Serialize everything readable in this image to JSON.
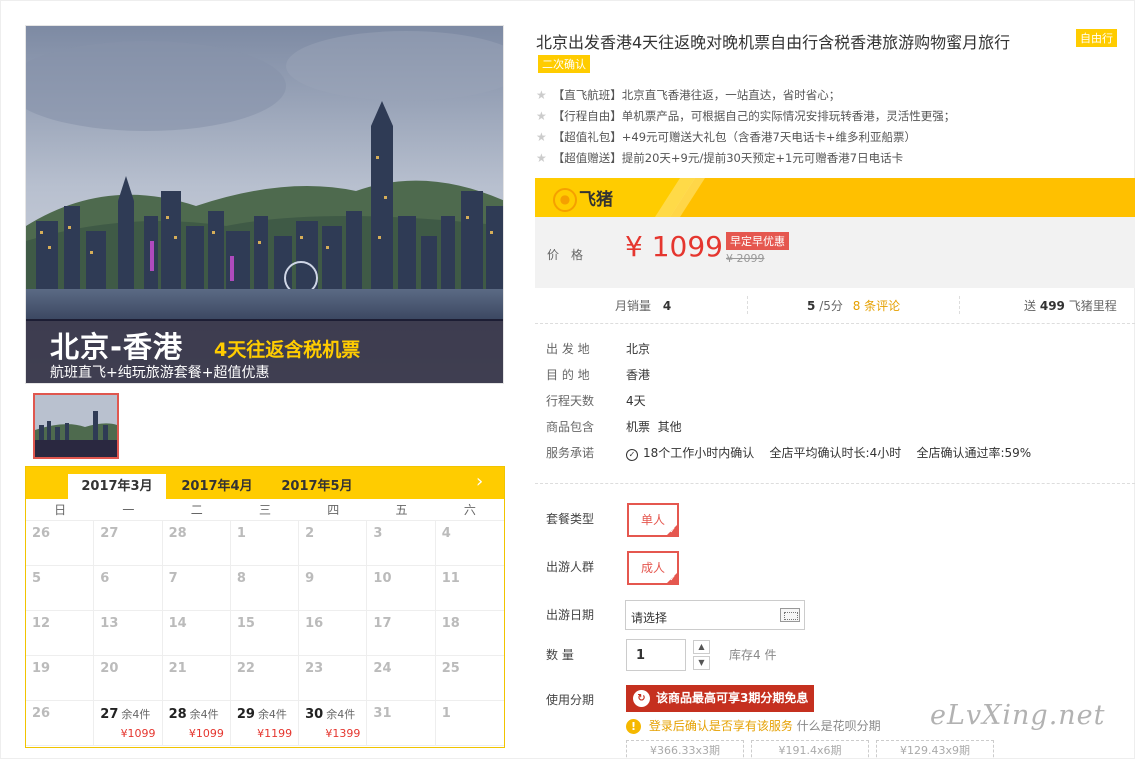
{
  "hero": {
    "title_main": "北京-香港",
    "title_sub": "4天往返含税机票",
    "caption": "航班直飞+纯玩旅游套餐+超值优惠"
  },
  "calendar": {
    "months": [
      "2017年3月",
      "2017年4月",
      "2017年5月"
    ],
    "weekdays": [
      "日",
      "一",
      "二",
      "三",
      "四",
      "五",
      "六"
    ],
    "cells": [
      {
        "day": "26"
      },
      {
        "day": "27"
      },
      {
        "day": "28"
      },
      {
        "day": "1"
      },
      {
        "day": "2"
      },
      {
        "day": "3"
      },
      {
        "day": "4"
      },
      {
        "day": "5"
      },
      {
        "day": "6"
      },
      {
        "day": "7"
      },
      {
        "day": "8"
      },
      {
        "day": "9"
      },
      {
        "day": "10"
      },
      {
        "day": "11"
      },
      {
        "day": "12"
      },
      {
        "day": "13"
      },
      {
        "day": "14"
      },
      {
        "day": "15"
      },
      {
        "day": "16"
      },
      {
        "day": "17"
      },
      {
        "day": "18"
      },
      {
        "day": "19"
      },
      {
        "day": "20"
      },
      {
        "day": "21"
      },
      {
        "day": "22"
      },
      {
        "day": "23"
      },
      {
        "day": "24"
      },
      {
        "day": "25"
      },
      {
        "day": "26"
      },
      {
        "day": "27",
        "stock": "余4件",
        "price": "¥1099"
      },
      {
        "day": "28",
        "stock": "余4件",
        "price": "¥1099"
      },
      {
        "day": "29",
        "stock": "余4件",
        "price": "¥1199"
      },
      {
        "day": "30",
        "stock": "余4件",
        "price": "¥1399"
      },
      {
        "day": "31"
      },
      {
        "day": "1"
      }
    ]
  },
  "product": {
    "title": "北京出发香港4天往返晚对晚机票自由行含税香港旅游购物蜜月旅行",
    "tag_type": "自由行",
    "tag_confirm": "二次确认",
    "features": [
      "【直飞航班】北京直飞香港往返，一站直达，省时省心；",
      "【行程自由】单机票产品，可根据自己的实际情况安排玩转香港，灵活性更强；",
      "【超值礼包】+49元可赠送大礼包（含香港7天电话卡+维多利亚船票）",
      "【超值赠送】提前20天+9元/提前30天预定+1元可赠香港7日电话卡"
    ]
  },
  "price": {
    "brand": "飞猪",
    "label": "价格",
    "current": "¥ 1099",
    "promo": "早定早优惠",
    "original": "¥ 2099"
  },
  "stats": {
    "monthly_label": "月销量",
    "monthly_value": "4",
    "score_value": "5",
    "score_suffix": "/5分",
    "reviews": "8 条评论",
    "mileage_prefix": "送",
    "mileage_value": "499",
    "mileage_suffix": "飞猪里程"
  },
  "attributes": [
    {
      "key": "出 发 地",
      "value": "北京"
    },
    {
      "key": "目 的 地",
      "value": "香港"
    },
    {
      "key": "行程天数",
      "value": "4天"
    },
    {
      "key": "商品包含",
      "value": "机票  其他"
    },
    {
      "key": "服务承诺",
      "value": "18个工作小时内确认    全店平均确认时长:4小时    全店确认通过率:59%"
    }
  ],
  "options": {
    "package_label": "套餐类型",
    "package_value": "单人",
    "crowd_label": "出游人群",
    "crowd_value": "成人",
    "date_label": "出游日期",
    "date_placeholder": "请选择",
    "qty_label": "数 量",
    "qty_value": "1",
    "stock": "库存4 件",
    "installment_label": "使用分期",
    "installment_button": "该商品最高可享3期分期免息",
    "login_tip_a": "登录后确认是否享有该服务",
    "login_tip_b": "什么是花呗分期",
    "plans": [
      "¥366.33x3期",
      "¥191.4x6期",
      "¥129.43x9期"
    ]
  },
  "watermark": "eLvXing.net",
  "colors": {
    "accent_yellow": "#ffcc00",
    "price_red": "#e5362f",
    "installment_red": "#c5301f"
  }
}
